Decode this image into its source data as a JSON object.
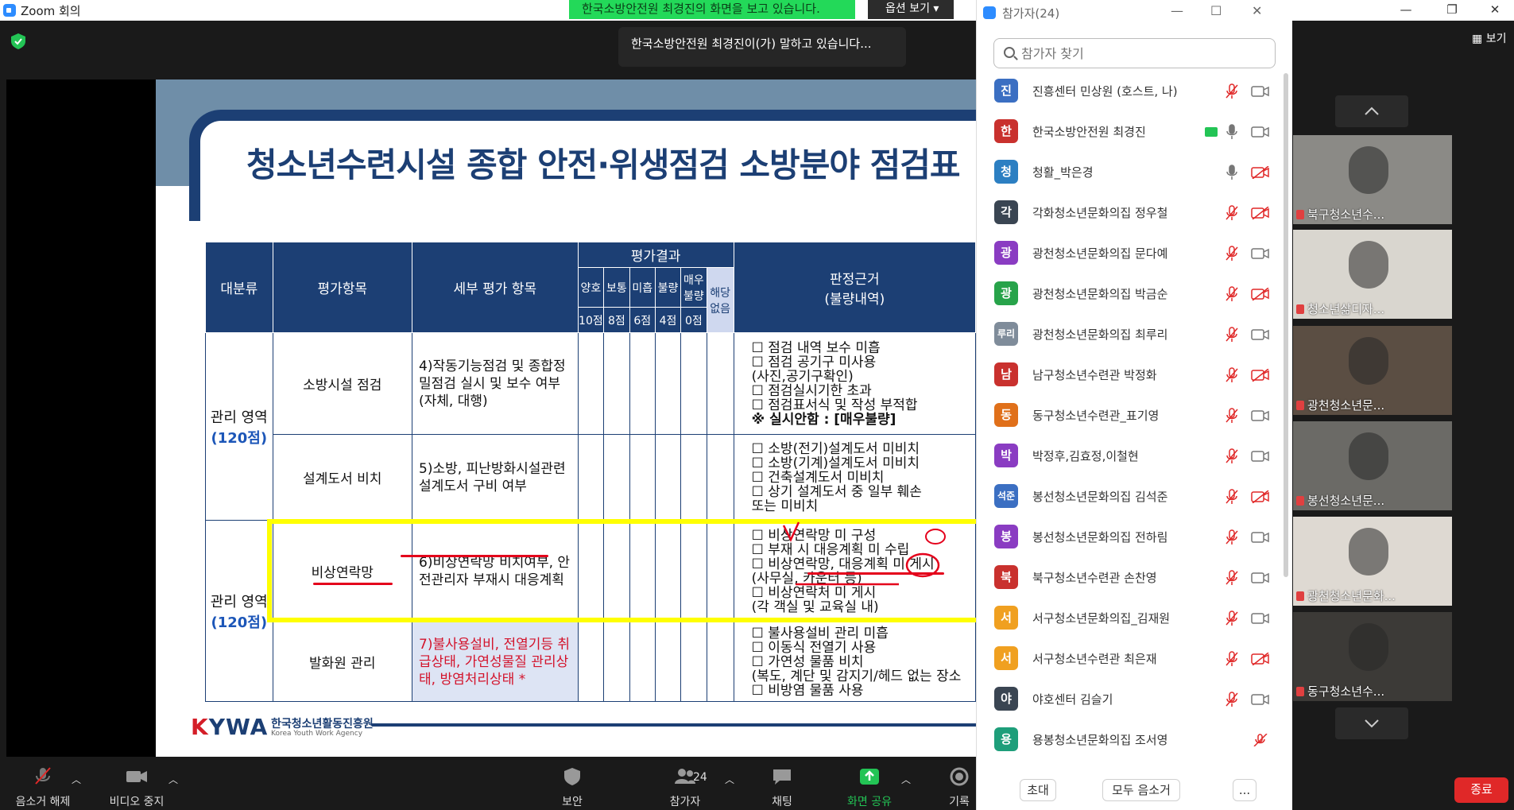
{
  "window": {
    "title": "Zoom 회의"
  },
  "share_banner": {
    "text": "한국소방안전원 최경진의 화면을 보고 있습니다.",
    "options": "옵션 보기"
  },
  "speaking_tooltip": "한국소방안전원 최경진이(가) 말하고 있습니다...",
  "gallery_toggle": "보기",
  "slide": {
    "heading": "청소년수련시설 종합 안전·위생점검 소방분야 점검표",
    "headers": {
      "category": "대분류",
      "eval_item": "평가항목",
      "detail_item": "세부 평가 항목",
      "result": "평가결과",
      "basis": "판정근거",
      "basis_sub": "(불량내역)",
      "grades": [
        "양호",
        "보통",
        "미흡",
        "불량",
        "매우불량",
        "해당없음"
      ],
      "points": [
        "10점",
        "8점",
        "6점",
        "4점",
        "0점"
      ]
    },
    "category_area": "관리 영역",
    "category_points": "(120점)",
    "rows": [
      {
        "item": "소방시설 점검",
        "detail": "4)작동기능점검 및 종합정밀점검 실시 및 보수 여부(자체, 대행)",
        "reasons": [
          "☐ 점검 내역 보수 미흡",
          "☐ 점검 공기구 미사용",
          "   (사진,공기구확인)",
          "☐ 점검실시기한 초과",
          "☐ 점검표서식 및 작성 부적합",
          "※ 실시안함 : [매우불량]"
        ]
      },
      {
        "item": "설계도서 비치",
        "detail": "5)소방, 피난방화시설관련 설계도서 구비 여부",
        "reasons": [
          "☐ 소방(전기)설계도서 미비치",
          "☐ 소방(기계)설계도서 미비치",
          "☐ 건축설계도서 미비치",
          "☐ 상기 설계도서 중 일부 훼손",
          "   또는 미비치"
        ]
      },
      {
        "item": "비상연락망",
        "detail": "6)비상연락망 비치여부, 안전관리자 부재시 대응계획",
        "reasons": [
          "☐ 비상연락망 미 구성",
          "☐ 부재 시 대응계획 미 수립",
          "☐ 비상연락망, 대응계획 미 게시",
          "   (사무실, 카운터 등)",
          "☐ 비상연락처 미 게시",
          "   (각 객실 및 교육실 내)"
        ]
      },
      {
        "item": "발화원 관리",
        "detail": "7)불사용설비, 전열기등 취급상태, 가연성물질 관리상태, 방염처리상태 *",
        "reasons": [
          "☐ 불사용설비 관리 미흡",
          "☐ 이동식 전열기 사용",
          "☐ 가연성 물품 비치",
          "(복도, 계단 및 감지기/헤드 없는 장소",
          "☐ 비방염 물품 사용"
        ]
      }
    ],
    "logo": {
      "mark_k": "K",
      "mark_rest": "YWA",
      "org": "한국청소년활동진흥원",
      "org_en": "Korea Youth Work Agency"
    }
  },
  "participants": {
    "title": "참가자(24)",
    "search_placeholder": "참가자 찾기",
    "list": [
      {
        "initial": "진",
        "name": "진흥센터 민상원 (호스트, 나)",
        "color": "#3b6fc2",
        "mic": "muted",
        "cam": "on"
      },
      {
        "initial": "한",
        "name": "한국소방안전원 최경진",
        "color": "#c9312e",
        "mic": "on",
        "cam": "on",
        "sharing": true
      },
      {
        "initial": "청",
        "name": "청활_박은경",
        "color": "#2c7fc2",
        "mic": "on",
        "cam": "off"
      },
      {
        "initial": "각",
        "name": "각화청소년문화의집 정우철",
        "color": "#3a4552",
        "mic": "muted",
        "cam": "off"
      },
      {
        "initial": "광",
        "name": "광천청소년문화의집 문다예",
        "color": "#8a3cc2",
        "mic": "muted",
        "cam": "on"
      },
      {
        "initial": "광",
        "name": "광천청소년문화의집 박금순",
        "color": "#27a34a",
        "mic": "muted",
        "cam": "off"
      },
      {
        "initial": "루리",
        "name": "광천청소년문화의집 최루리",
        "color": "#7f8c9a",
        "mic": "muted",
        "cam": "on"
      },
      {
        "initial": "남",
        "name": "남구청소년수련관 박정화",
        "color": "#c9312e",
        "mic": "muted",
        "cam": "off"
      },
      {
        "initial": "동",
        "name": "동구청소년수련관_표기영",
        "color": "#e0701a",
        "mic": "muted",
        "cam": "on"
      },
      {
        "initial": "박",
        "name": "박정후,김효정,이철현",
        "color": "#8a3cc2",
        "mic": "muted",
        "cam": "on"
      },
      {
        "initial": "석준",
        "name": "봉선청소년문화의집 김석준",
        "color": "#3b6fc2",
        "mic": "muted",
        "cam": "off"
      },
      {
        "initial": "봉",
        "name": "봉선청소년문화의집 전하림",
        "color": "#8a3cc2",
        "mic": "muted",
        "cam": "on"
      },
      {
        "initial": "북",
        "name": "북구청소년수련관 손찬영",
        "color": "#c9312e",
        "mic": "muted",
        "cam": "on"
      },
      {
        "initial": "서",
        "name": "서구청소년문화의집_김재원",
        "color": "#f0a020",
        "mic": "muted",
        "cam": "on"
      },
      {
        "initial": "서",
        "name": "서구청소년수련관 최은재",
        "color": "#f0a020",
        "mic": "muted",
        "cam": "off"
      },
      {
        "initial": "야",
        "name": "야호센터 김슬기",
        "color": "#3a4552",
        "mic": "muted",
        "cam": "on"
      },
      {
        "initial": "용",
        "name": "용봉청소년문화의집 조서영",
        "color": "#1e9e7a",
        "mic": "none",
        "cam": "muted"
      }
    ],
    "buttons": {
      "invite": "초대",
      "mute_all": "모두 음소거",
      "more": "..."
    }
  },
  "videos": [
    {
      "label": "북구청소년수...",
      "bg": "#8b8a86"
    },
    {
      "label": "청소년삶디자...",
      "bg": "#d9d6cf"
    },
    {
      "label": "광천청소년문...",
      "bg": "#5b4e43"
    },
    {
      "label": "봉선청소년문...",
      "bg": "#6b6a66"
    },
    {
      "label": "광천청소년문화...",
      "bg": "#ded9d2"
    },
    {
      "label": "동구청소년수...",
      "bg": "#3c3a37"
    }
  ],
  "toolbar": {
    "unmute": "음소거 해제",
    "stop_video": "비디오 중지",
    "security": "보안",
    "participants": "참가자",
    "participants_count": "24",
    "chat": "채팅",
    "share": "화면 공유",
    "record": "기록",
    "end": "종료"
  }
}
